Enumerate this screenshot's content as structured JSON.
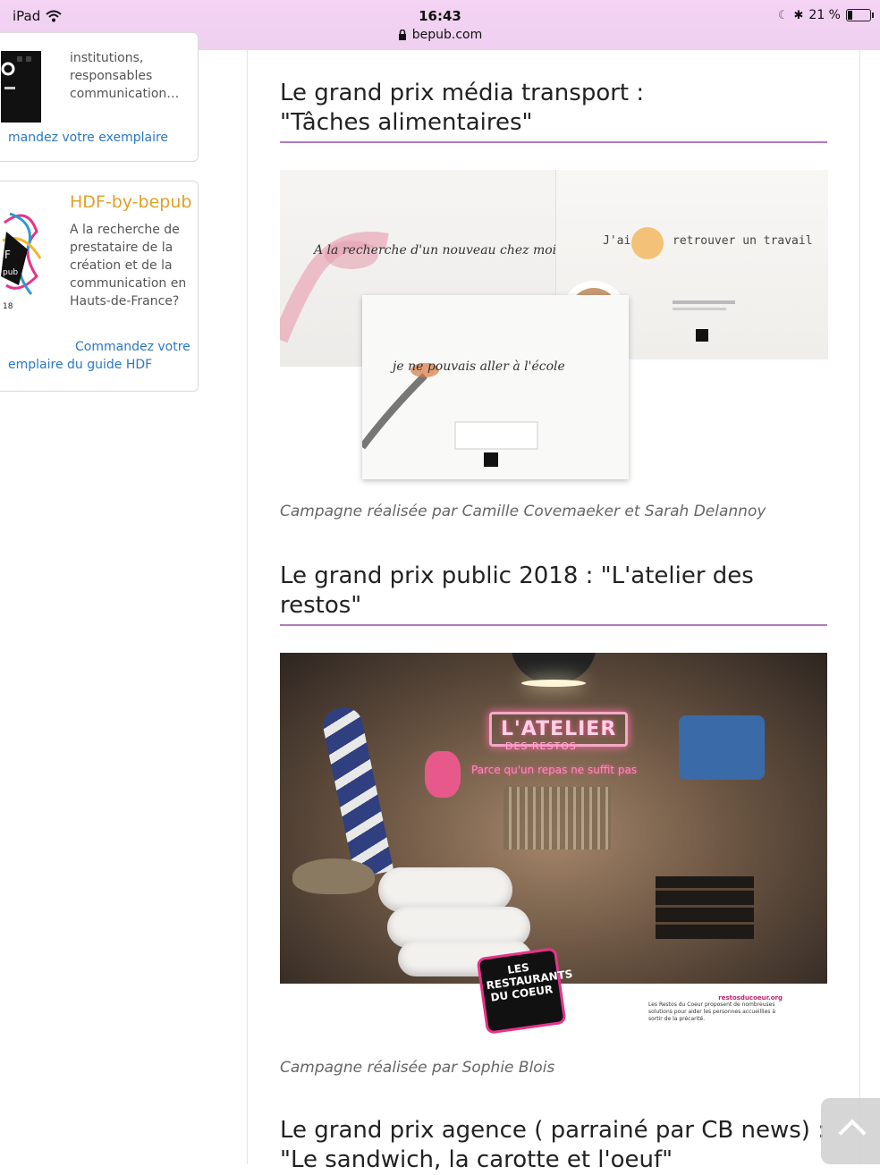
{
  "status_bar": {
    "device": "iPad",
    "time": "16:43",
    "url": "bepub.com",
    "battery": "21 %"
  },
  "sidebar": {
    "card1": {
      "text": "institutions, responsables communication…",
      "link": "mandez votre exemplaire"
    },
    "card2": {
      "title": "HDF-by-bepub",
      "text": "A la recherche de prestataire de la création et de la communication en Hauts-de-France?",
      "link_line1": "Commandez votre",
      "link_line2": "emplaire du guide HDF"
    }
  },
  "main": {
    "section1": {
      "title_line1": "Le grand prix média transport :",
      "title_line2": "\"Tâches alimentaires\"",
      "image_texts": {
        "a": "A la recherche d'un nouveau chez moi",
        "b_left": "J'ai",
        "b_right": "retrouver un travail",
        "c": "je ne pouvais aller à l'école"
      },
      "caption": "Campagne réalisée par Camille Covemaeker et Sarah Delannoy"
    },
    "section2": {
      "title_line1": "Le grand prix public 2018 : \"L'atelier des",
      "title_line2": "restos\"",
      "poster": {
        "neon_title": "L'ATELIER",
        "neon_sub": "DES RESTOS",
        "neon_tag": "Parce qu'un repas ne suffit pas",
        "logo": "LES RESTAURANTS DU COEUR",
        "site": "restosducoeur.org",
        "footnote": "Les Restos du Coeur proposent de nombreuses solutions pour aider les personnes accueillies à sortir de la précarité."
      },
      "caption": "Campagne réalisée par Sophie Blois"
    },
    "section3": {
      "title_line1": "Le grand prix agence ( parrainé par CB news) :",
      "title_line2": "\"Le sandwich, la carotte et l'oeuf\""
    }
  },
  "colors": {
    "accent_underline": "#b57bbd",
    "link": "#2b78c4",
    "card_title": "#e0a02a",
    "status_bar": "#f4d3f4"
  }
}
